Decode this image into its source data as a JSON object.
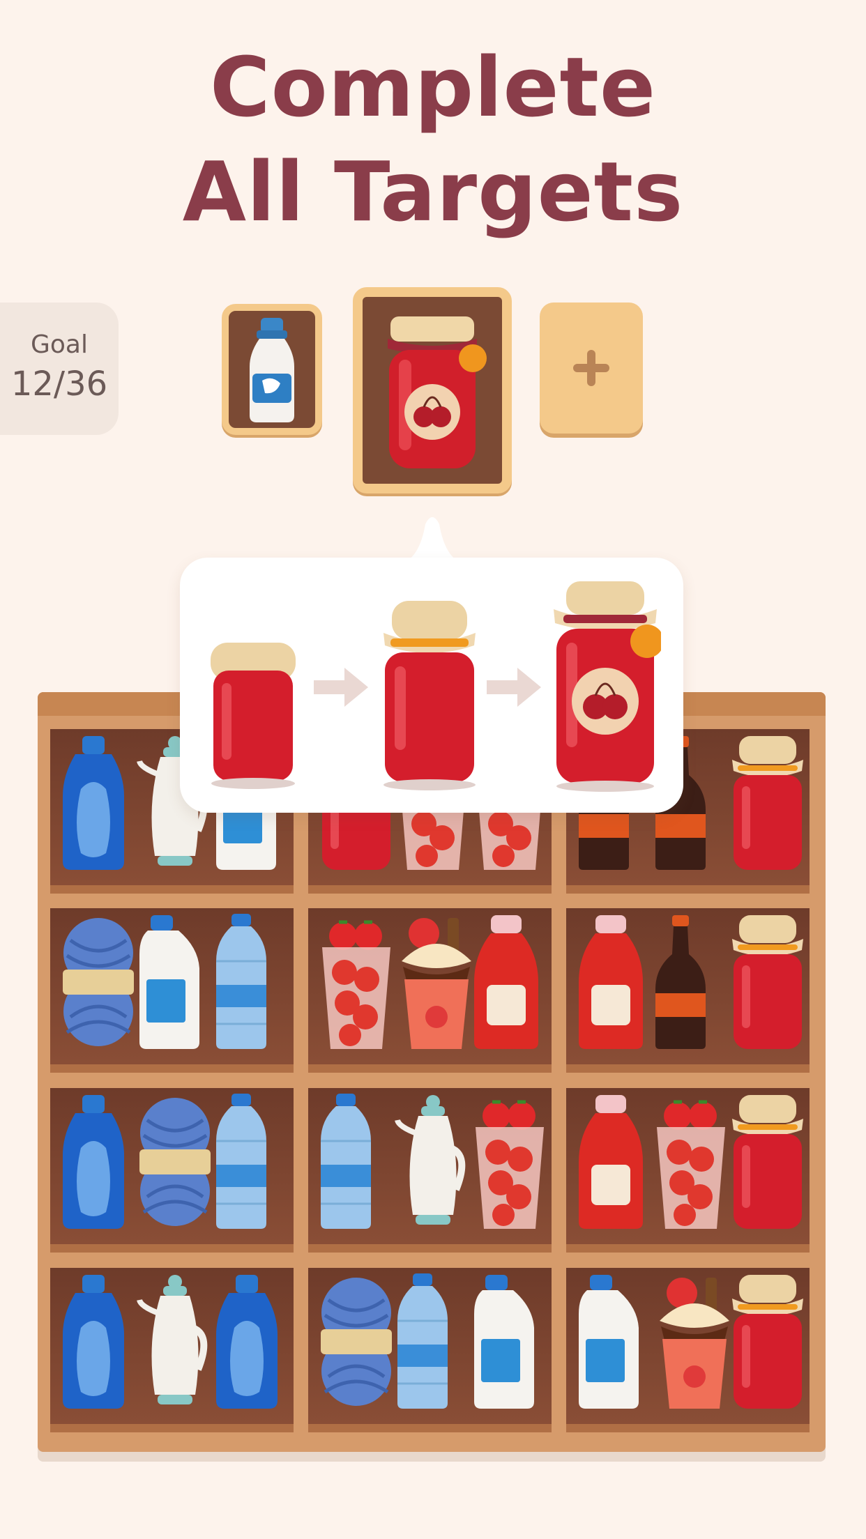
{
  "title": {
    "line1": "Complete",
    "line2": "All Targets"
  },
  "goal": {
    "label": "Goal",
    "count": "12/36"
  },
  "targets": [
    {
      "item": "milk-bottle-icon",
      "state": "filled"
    },
    {
      "item": "cherry-jam-jar-icon",
      "state": "selected"
    },
    {
      "item": "add-slot",
      "state": "empty"
    }
  ],
  "upgrade_popup": {
    "stages": [
      "jam-jar-plain-icon",
      "jam-jar-ribbon-icon",
      "cherry-jam-jar-icon"
    ]
  },
  "shelf": {
    "rows": [
      [
        [
          "detergent",
          "teapot",
          "milk-jug"
        ],
        [
          "jam",
          "tomato-cup",
          "tomato-cup"
        ],
        [
          "cola",
          "cola",
          "jam"
        ]
      ],
      [
        [
          "yarn",
          "milk-jug",
          "water-bottle"
        ],
        [
          "tomato-cup",
          "strawberry-sundae",
          "ketchup"
        ],
        [
          "ketchup",
          "cola",
          "jam"
        ]
      ],
      [
        [
          "detergent",
          "yarn",
          "water-bottle"
        ],
        [
          "water-bottle",
          "teapot",
          "tomato-cup"
        ],
        [
          "ketchup",
          "tomato-cup",
          "jam"
        ]
      ],
      [
        [
          "detergent",
          "teapot",
          "detergent"
        ],
        [
          "yarn",
          "water-bottle",
          "milk-jug"
        ],
        [
          "milk-jug",
          "strawberry-sundae",
          "jam"
        ]
      ]
    ]
  },
  "colors": {
    "title": "#8a3d4a",
    "background": "#fdf3ec",
    "shelf_wood": "#d69b6b",
    "cell_back": "#6e3b2a",
    "slot_frame": "#f4c98a"
  }
}
